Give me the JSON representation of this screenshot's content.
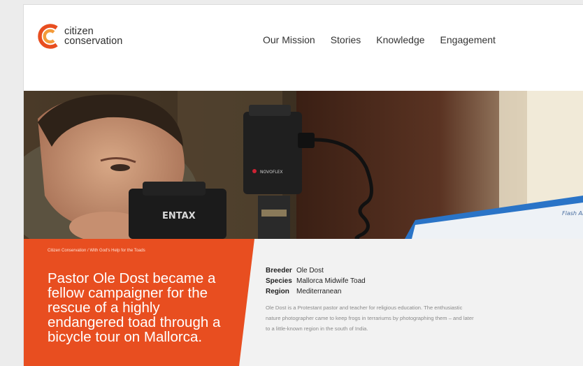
{
  "brand": {
    "name_line1": "citizen",
    "name_line2": "conservation",
    "colors": {
      "accent": "#e84e20",
      "accent_light": "#f39b3a"
    },
    "icon": "cc-logo-icon"
  },
  "nav": {
    "items": [
      {
        "label": "Our Mission"
      },
      {
        "label": "Stories"
      },
      {
        "label": "Knowledge"
      },
      {
        "label": "Engagement"
      }
    ]
  },
  "hero": {
    "image": "man-photographing-with-camera-and-flash-photo",
    "camera_brand": "ENTAX",
    "flash_brand": "NOVOFLEX",
    "monitor_text": "Flash Art"
  },
  "story": {
    "breadcrumb": "Citizen Conservation / With God's Help for the Toads",
    "headline": "Pastor Ole Dost became a fellow campaigner for the rescue of a highly endangered toad through a bicycle tour on Mallorca.",
    "facts": [
      {
        "key": "Breeder",
        "value": "Ole Dost"
      },
      {
        "key": "Species",
        "value": "Mallorca Midwife Toad"
      },
      {
        "key": "Region",
        "value": "Mediterranean"
      }
    ],
    "description": "Ole Dost is a Protestant pastor and teacher for religious education. The enthusiastic nature photographer came to keep frogs in terrariums by photographing them – and later to a little-known region in the south of India."
  }
}
